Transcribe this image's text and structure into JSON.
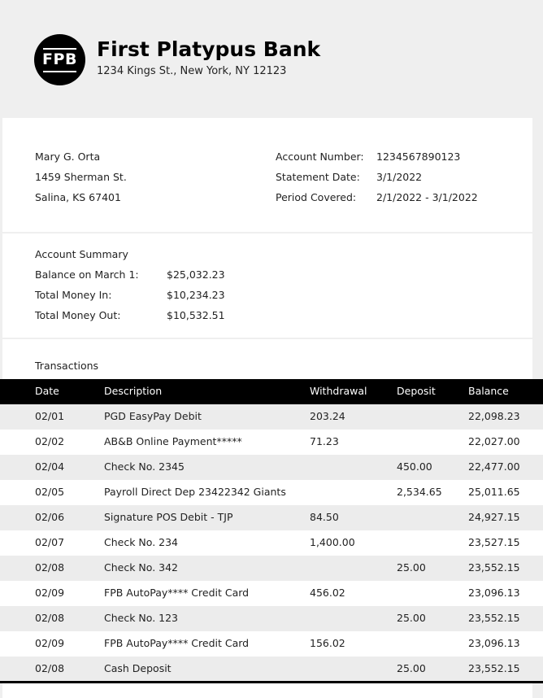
{
  "bank": {
    "logo": "FPB",
    "name": "First Platypus Bank",
    "address": "1234 Kings St., New York, NY 12123"
  },
  "customer": {
    "name": "Mary G. Orta",
    "street": "1459 Sherman St.",
    "city": "Salina, KS 67401"
  },
  "account": {
    "number_label": "Account Number:",
    "number": "1234567890123",
    "date_label": "Statement Date:",
    "date": "3/1/2022",
    "period_label": "Period Covered:",
    "period": "2/1/2022 - 3/1/2022"
  },
  "summary": {
    "title": "Account Summary",
    "items": [
      {
        "label": "Balance on March 1:",
        "value": "$25,032.23"
      },
      {
        "label": "Total Money In:",
        "value": "$10,234.23"
      },
      {
        "label": "Total Money Out:",
        "value": "$10,532.51"
      }
    ]
  },
  "transactions": {
    "title": "Transactions",
    "headers": {
      "date": "Date",
      "description": "Description",
      "withdrawal": "Withdrawal",
      "deposit": "Deposit",
      "balance": "Balance"
    },
    "rows": [
      {
        "date": "02/01",
        "description": "PGD EasyPay Debit",
        "withdrawal": "203.24",
        "deposit": "",
        "balance": "22,098.23"
      },
      {
        "date": "02/02",
        "description": "AB&B Online Payment*****",
        "withdrawal": "71.23",
        "deposit": "",
        "balance": "22,027.00"
      },
      {
        "date": "02/04",
        "description": "Check No. 2345",
        "withdrawal": "",
        "deposit": "450.00",
        "balance": "22,477.00"
      },
      {
        "date": "02/05",
        "description": "Payroll Direct Dep 23422342 Giants",
        "withdrawal": "",
        "deposit": "2,534.65",
        "balance": "25,011.65"
      },
      {
        "date": "02/06",
        "description": "Signature POS Debit - TJP",
        "withdrawal": "84.50",
        "deposit": "",
        "balance": "24,927.15"
      },
      {
        "date": "02/07",
        "description": "Check No. 234",
        "withdrawal": "1,400.00",
        "deposit": "",
        "balance": "23,527.15"
      },
      {
        "date": "02/08",
        "description": "Check No. 342",
        "withdrawal": "",
        "deposit": "25.00",
        "balance": "23,552.15"
      },
      {
        "date": "02/09",
        "description": "FPB AutoPay**** Credit Card",
        "withdrawal": "456.02",
        "deposit": "",
        "balance": "23,096.13"
      },
      {
        "date": "02/08",
        "description": "Check No. 123",
        "withdrawal": "",
        "deposit": "25.00",
        "balance": "23,552.15"
      },
      {
        "date": "02/09",
        "description": "FPB AutoPay**** Credit Card",
        "withdrawal": "156.02",
        "deposit": "",
        "balance": "23,096.13"
      },
      {
        "date": "02/08",
        "description": "Cash Deposit",
        "withdrawal": "",
        "deposit": "25.00",
        "balance": "23,552.15"
      }
    ]
  }
}
